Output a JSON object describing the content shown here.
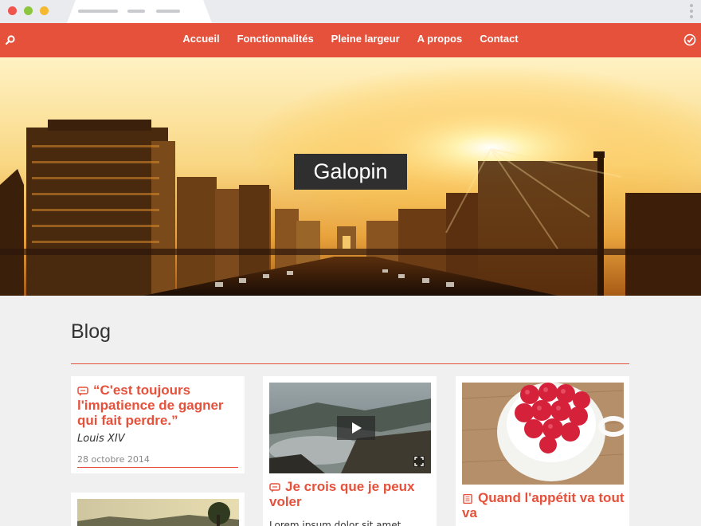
{
  "browser": {
    "window_controls": [
      "close",
      "minimize",
      "maximize"
    ]
  },
  "navbar": {
    "items": [
      "Accueil",
      "Fonctionnalités",
      "Pleine largeur",
      "A propos",
      "Contact"
    ],
    "search_icon": "search-icon",
    "status_icon": "check-circle-icon",
    "color": "#e5513b"
  },
  "hero": {
    "title": "Galopin"
  },
  "blog": {
    "heading": "Blog",
    "posts": [
      {
        "type": "quote",
        "icon": "speech-bubble-icon",
        "title": "“C'est toujours l'impatience de gagner qui fait perdre.”",
        "author": "Louis XIV",
        "date": "28 octobre 2014"
      },
      {
        "type": "video",
        "icon": "speech-bubble-icon",
        "title": "Je crois que je peux voler",
        "excerpt": "Lorem ipsum dolor sit amet"
      },
      {
        "type": "standard",
        "icon": "document-icon",
        "title": "Quand l'appétit va tout va"
      },
      {
        "type": "image",
        "icon": "image-icon"
      }
    ]
  }
}
